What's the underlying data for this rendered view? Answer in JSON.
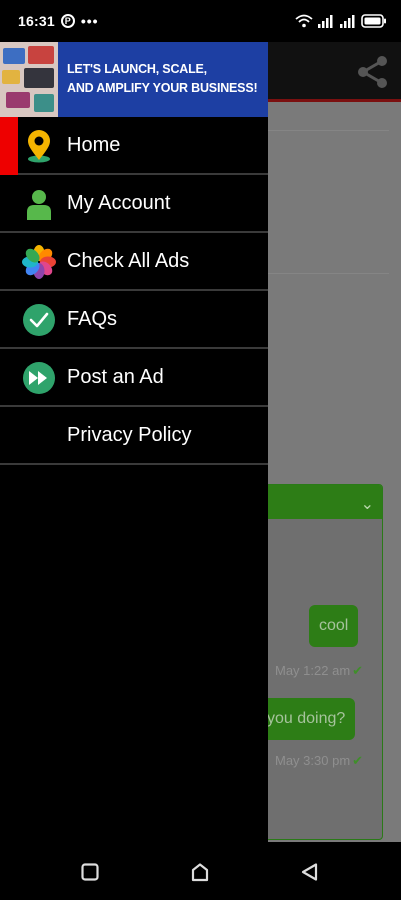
{
  "status_bar": {
    "time": "16:31",
    "p_badge": "P",
    "more": "•••",
    "wifi_icon": "wifi-icon",
    "signal_icon": "signal-icon",
    "battery_icon": "battery-icon"
  },
  "drawer": {
    "banner": {
      "line1": "LET'S LAUNCH, SCALE,",
      "line2": "AND AMPLIFY YOUR BUSINESS!"
    },
    "items": [
      {
        "label": "Home",
        "icon": "location-pin-icon",
        "active": true
      },
      {
        "label": "My Account",
        "icon": "user-icon",
        "active": false
      },
      {
        "label": "Check All Ads",
        "icon": "photos-flower-icon",
        "active": false
      },
      {
        "label": "FAQs",
        "icon": "check-circle-icon",
        "active": false
      },
      {
        "label": "Post an Ad",
        "icon": "fast-forward-icon",
        "active": false
      },
      {
        "label": "Privacy Policy",
        "icon": "",
        "active": false
      }
    ],
    "colors": {
      "active_marker": "#ee0000",
      "banner_bg": "#1d3fa3",
      "icon_green": "#2fa36b"
    }
  },
  "background_chat": {
    "messages": [
      {
        "text": "cool",
        "time": "May 1:22 am"
      },
      {
        "text": "you doing?",
        "time": "May 3:30 pm"
      }
    ],
    "accent": "#2d7d16"
  },
  "nav_bar": {
    "recent_icon": "square-icon",
    "home_icon": "home-icon",
    "back_icon": "triangle-back-icon"
  }
}
